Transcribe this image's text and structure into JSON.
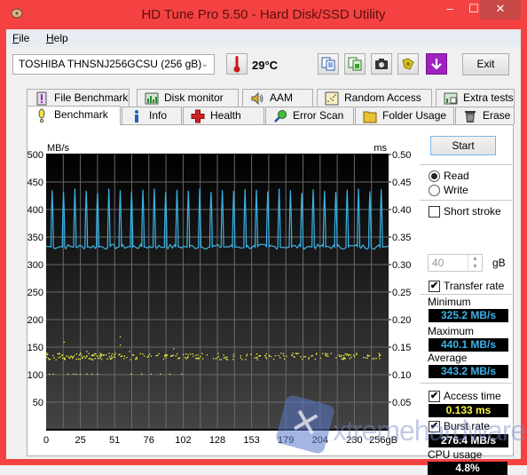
{
  "window": {
    "title": "HD Tune Pro 5.50 - Hard Disk/SSD Utility",
    "controls": {
      "minimize": "–",
      "maximize": "☐",
      "close": "✕"
    },
    "frame_color": "#f44242"
  },
  "menu": {
    "items": [
      {
        "label": "File",
        "mnemonic": "F"
      },
      {
        "label": "Help",
        "mnemonic": "H"
      }
    ]
  },
  "toolbar": {
    "drive": "TOSHIBA THNSNJ256GCSU (256 gB)",
    "temperature": "29°C",
    "icons": [
      "copy-text-icon",
      "copy-info-icon",
      "screenshot-camera-icon",
      "options-icon",
      "save-down-arrow-icon"
    ],
    "exit_label": "Exit"
  },
  "tabs": {
    "top_row": [
      {
        "label": "File Benchmark",
        "icon": "file-benchmark-icon"
      },
      {
        "label": "Disk monitor",
        "icon": "disk-monitor-icon"
      },
      {
        "label": "AAM",
        "icon": "speaker-icon"
      },
      {
        "label": "Random Access",
        "icon": "random-access-icon"
      },
      {
        "label": "Extra tests",
        "icon": "extra-tests-icon"
      }
    ],
    "bottom_row": [
      {
        "label": "Benchmark",
        "icon": "exclamation-icon",
        "active": true
      },
      {
        "label": "Info",
        "icon": "info-icon"
      },
      {
        "label": "Health",
        "icon": "health-cross-icon"
      },
      {
        "label": "Error Scan",
        "icon": "magnifier-icon"
      },
      {
        "label": "Folder Usage",
        "icon": "folder-icon"
      },
      {
        "label": "Erase",
        "icon": "trash-icon"
      }
    ]
  },
  "controls": {
    "start_label": "Start",
    "mode_options": [
      {
        "label": "Read",
        "selected": true
      },
      {
        "label": "Write",
        "selected": false
      }
    ],
    "short_stroke": {
      "label": "Short stroke",
      "checked": false
    },
    "short_stroke_value": "40",
    "short_stroke_unit": "gB",
    "transfer_rate": {
      "label": "Transfer rate",
      "checked": true
    },
    "minimum_label": "Minimum",
    "minimum_value": "325.2 MB/s",
    "maximum_label": "Maximum",
    "maximum_value": "440.1 MB/s",
    "average_label": "Average",
    "average_value": "343.2 MB/s",
    "access_time": {
      "label": "Access time",
      "checked": true
    },
    "access_time_value": "0.133 ms",
    "burst_rate": {
      "label": "Burst rate",
      "checked": true
    },
    "burst_rate_value": "276.4 MB/s",
    "cpu_label": "CPU usage",
    "cpu_value": "4.8%",
    "colors": {
      "transfer": "#3ab4e8",
      "access": "#f5f542",
      "burst": "#ffffff"
    }
  },
  "watermark": "xtremehardware.com",
  "chart_data": {
    "type": "line",
    "title": "",
    "xlabel": "gB",
    "ylabel_left": "MB/s",
    "ylabel_right": "ms",
    "xlim": [
      0,
      256
    ],
    "ylim_left": [
      0,
      500
    ],
    "ylim_right": [
      0,
      0.5
    ],
    "x_ticks": [
      "0",
      "25",
      "51",
      "76",
      "102",
      "128",
      "153",
      "179",
      "204",
      "230",
      "256gB"
    ],
    "y_ticks_left": [
      "500",
      "450",
      "400",
      "350",
      "300",
      "250",
      "200",
      "150",
      "100",
      "50"
    ],
    "y_ticks_right": [
      "0.50",
      "0.45",
      "0.40",
      "0.35",
      "0.30",
      "0.25",
      "0.20",
      "0.15",
      "0.10",
      "0.05"
    ],
    "grid": true,
    "series": [
      {
        "name": "Transfer rate (MB/s)",
        "color": "#3ab4e8",
        "baseline": 332,
        "spike_values": [
          435,
          432,
          438,
          434,
          430,
          438,
          435,
          433,
          436,
          438,
          432,
          436,
          434,
          438,
          432,
          435,
          434,
          437,
          436,
          433,
          438,
          435,
          430,
          437,
          434,
          432,
          436,
          438,
          433,
          437
        ],
        "spike_count": 30,
        "min": 325.2,
        "max": 440.1,
        "avg": 343.2
      },
      {
        "name": "Access time (ms)",
        "color": "#f5f542",
        "type": "scatter",
        "main_band": 0.133,
        "band_range": [
          0.128,
          0.14
        ],
        "outliers_low": 0.102,
        "outliers_high": [
          0.16,
          0.17,
          0.155,
          0.148
        ]
      }
    ]
  }
}
